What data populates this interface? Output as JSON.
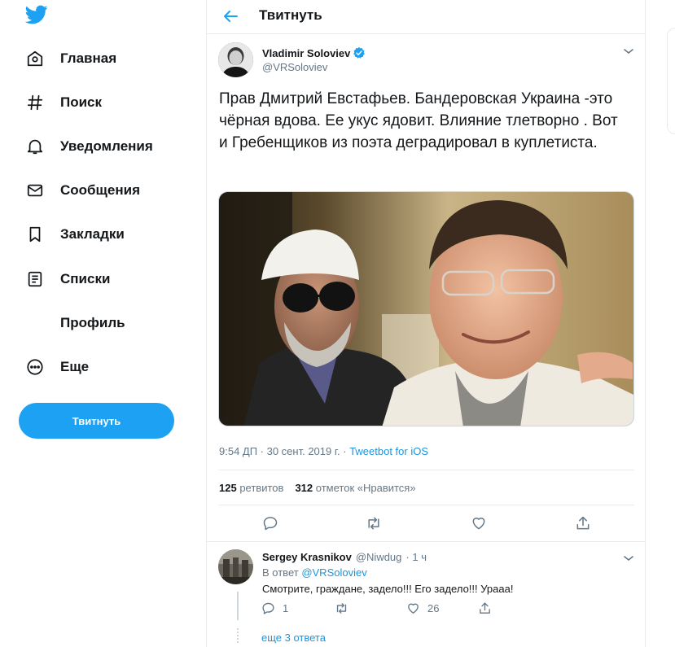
{
  "colors": {
    "accent": "#1da1f2",
    "link": "#1b95e0",
    "muted": "#657786",
    "text": "#14171a",
    "border": "#e6ecf0"
  },
  "nav": {
    "items": [
      {
        "label": "Главная",
        "icon": "home-icon"
      },
      {
        "label": "Поиск",
        "icon": "hashtag-icon"
      },
      {
        "label": "Уведомления",
        "icon": "bell-icon"
      },
      {
        "label": "Сообщения",
        "icon": "envelope-icon"
      },
      {
        "label": "Закладки",
        "icon": "bookmark-icon"
      },
      {
        "label": "Списки",
        "icon": "list-icon"
      },
      {
        "label": "Профиль",
        "icon": "profile-icon"
      },
      {
        "label": "Еще",
        "icon": "more-icon"
      }
    ],
    "tweet_button": "Твитнуть"
  },
  "header": {
    "title": "Твитнуть"
  },
  "tweet": {
    "author_name": "Vladimir Soloviev",
    "author_handle": "@VRSoloviev",
    "text": "Прав Дмитрий Евстафьев. Бандеровская Украина -это чёрная вдова. Ее укус ядовит. Влияние тлетворно . Вот и Гребенщиков из поэта деградировал в куплетиста.",
    "time": "9:54 ДП · 30 сент. 2019 г. · ",
    "source": "Tweetbot for iOS",
    "retweets_count": "125",
    "retweets_label": "ретвитов",
    "likes_count": "312",
    "likes_label": "отметок «Нравится»"
  },
  "reply": {
    "author_name": "Sergey Krasnikov",
    "author_handle": "@Niwdug",
    "time": "· 1 ч",
    "in_reply_prefix": "В ответ ",
    "in_reply_handle": "@VRSoloviev",
    "text": "Смотрите, граждане, задело!!! Его задело!!! Урааа!",
    "reply_count": "1",
    "like_count": "26",
    "more_replies": "еще 3 ответа"
  }
}
